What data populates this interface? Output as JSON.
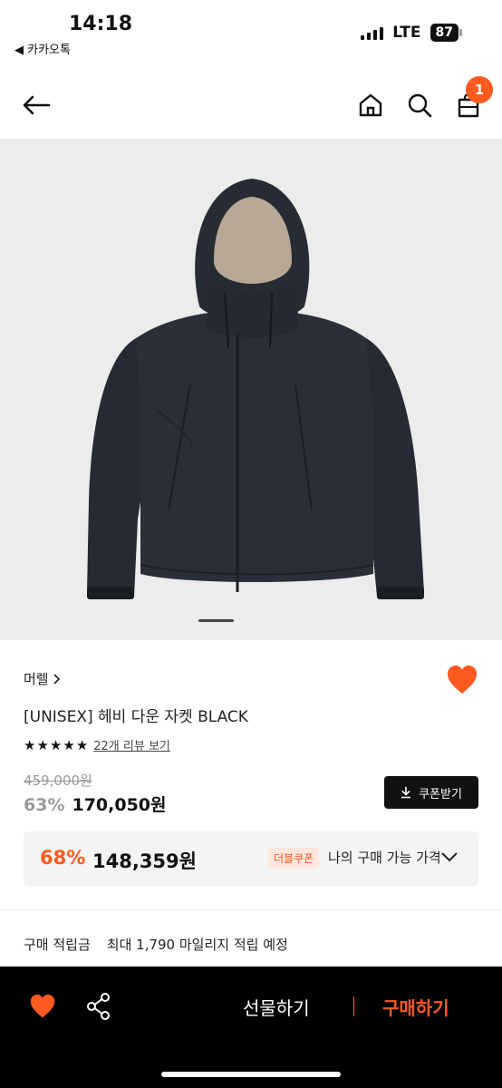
{
  "status_bar": {
    "time": "14:18",
    "back_app": "◀ 카카오톡",
    "network": "LTE",
    "battery": "87"
  },
  "header": {
    "cart_count": "1"
  },
  "product": {
    "brand": "머렐",
    "name": "[UNISEX] 헤비 다운 자켓 BLACK",
    "rating_stars": 5,
    "review_link": "22개 리뷰 보기",
    "original_price": "459,000원",
    "discount_rate": "63%",
    "sale_price": "170,050원",
    "coupon_button": "쿠폰받기"
  },
  "my_price": {
    "rate": "68%",
    "price": "148,359원",
    "badge": "더블쿠폰",
    "label": "나의 구매 가능 가격"
  },
  "points": {
    "label": "구매 적립금",
    "value": "최대 1,790 마일리지 적립 예정"
  },
  "bottom_bar": {
    "gift": "선물하기",
    "buy": "구매하기"
  },
  "colors": {
    "accent": "#ff5a1f",
    "dark": "#111111",
    "jacket": "#262a33",
    "lining": "#b6a894"
  },
  "icons": [
    "back-arrow-icon",
    "home-icon",
    "search-icon",
    "shopping-bag-icon",
    "heart-icon",
    "download-icon",
    "chevron-down-icon",
    "share-icon",
    "chevron-right-icon"
  ]
}
